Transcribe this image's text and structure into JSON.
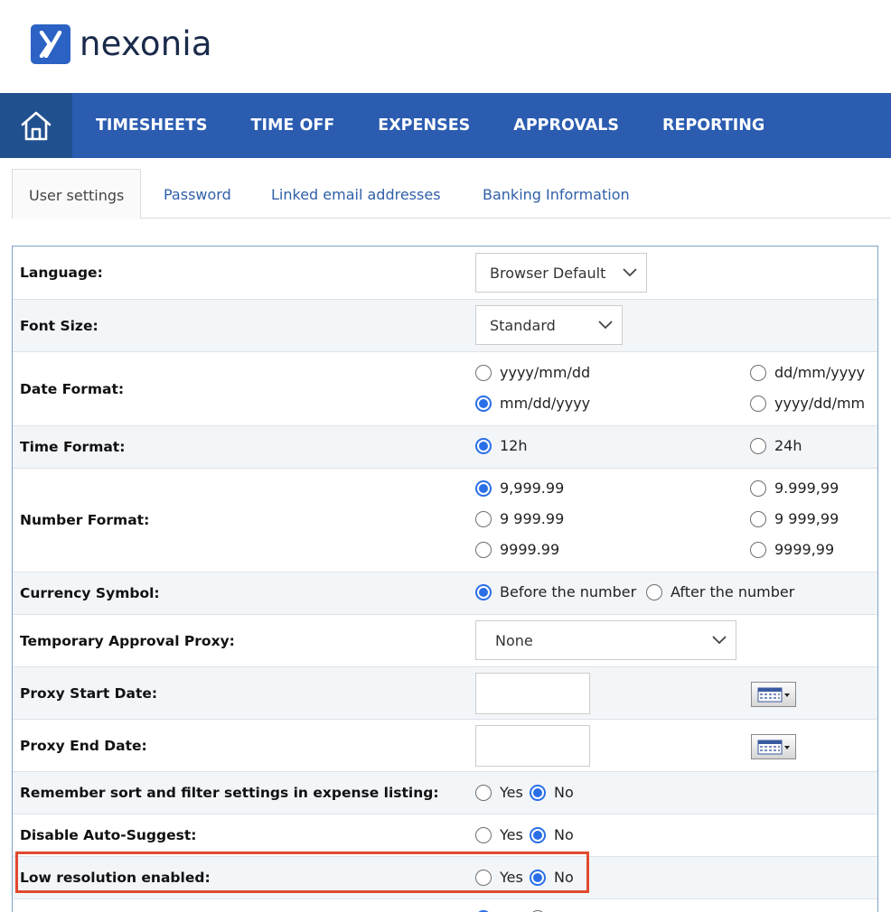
{
  "brand": {
    "name": "nexonia",
    "logo_letter": "X",
    "color": "#2b62c4"
  },
  "nav": {
    "home_icon": "home-icon",
    "items": [
      {
        "label": "TIMESHEETS"
      },
      {
        "label": "TIME OFF"
      },
      {
        "label": "EXPENSES"
      },
      {
        "label": "APPROVALS"
      },
      {
        "label": "REPORTING"
      }
    ]
  },
  "tabs": [
    {
      "label": "User settings",
      "active": true
    },
    {
      "label": "Password"
    },
    {
      "label": "Linked email addresses"
    },
    {
      "label": "Banking Information"
    }
  ],
  "settings": {
    "language": {
      "label": "Language:",
      "value": "Browser Default"
    },
    "font_size": {
      "label": "Font Size:",
      "value": "Standard"
    },
    "date_format": {
      "label": "Date Format:",
      "options": [
        "yyyy/mm/dd",
        "dd/mm/yyyy",
        "mm/dd/yyyy",
        "yyyy/dd/mm"
      ],
      "selected": "mm/dd/yyyy"
    },
    "time_format": {
      "label": "Time Format:",
      "options": [
        "12h",
        "24h"
      ],
      "selected": "12h"
    },
    "number_format": {
      "label": "Number Format:",
      "options": [
        "9,999.99",
        "9.999,99",
        "9 999.99",
        "9 999,99",
        "9999.99",
        "9999,99"
      ],
      "selected": "9,999.99"
    },
    "currency_symbol": {
      "label": "Currency Symbol:",
      "options": [
        "Before the number",
        "After the number"
      ],
      "selected": "Before the number"
    },
    "approval_proxy": {
      "label": "Temporary Approval Proxy:",
      "value": "None"
    },
    "proxy_start": {
      "label": "Proxy Start Date:",
      "value": ""
    },
    "proxy_end": {
      "label": "Proxy End Date:",
      "value": ""
    },
    "remember_sort": {
      "label": "Remember sort and filter settings in expense listing:",
      "yes": "Yes",
      "no": "No",
      "selected": "No"
    },
    "auto_suggest": {
      "label": "Disable Auto-Suggest:",
      "yes": "Yes",
      "no": "No",
      "selected": "No"
    },
    "low_res": {
      "label": "Low resolution enabled:",
      "yes": "Yes",
      "no": "No",
      "selected": "No"
    }
  },
  "colors": {
    "nav_bg": "#2b5cb0",
    "home_bg": "#21508f",
    "link": "#2f5fa8",
    "radio_on": "#2a6fe8",
    "highlight": "#e24a2f"
  }
}
